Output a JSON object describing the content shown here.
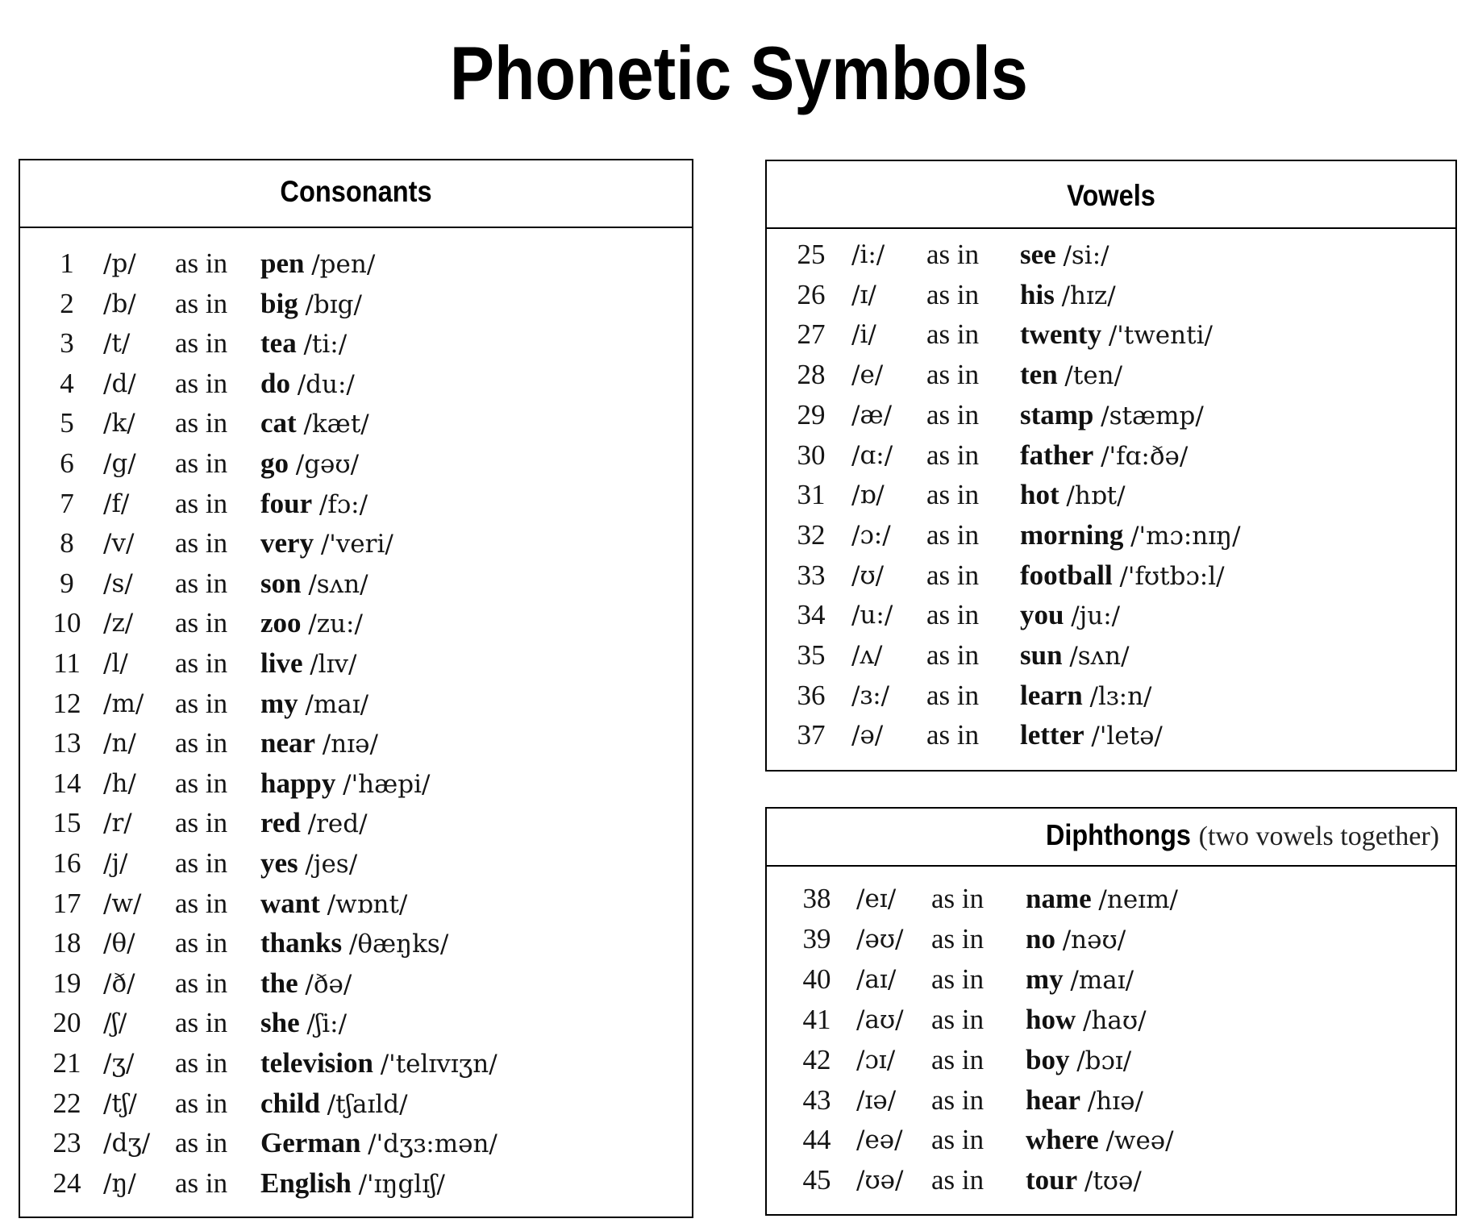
{
  "title": "Phonetic Symbols",
  "consonants": {
    "heading": "Consonants",
    "rows": [
      {
        "n": "1",
        "sym": "/p/",
        "as_in": "as in",
        "word": "pen",
        "ipa": "/pen/"
      },
      {
        "n": "2",
        "sym": "/b/",
        "as_in": "as in",
        "word": "big",
        "ipa": "/bɪg/"
      },
      {
        "n": "3",
        "sym": "/t/",
        "as_in": "as in",
        "word": "tea",
        "ipa": "/ti:/"
      },
      {
        "n": "4",
        "sym": "/d/",
        "as_in": "as in",
        "word": "do",
        "ipa": "/du:/"
      },
      {
        "n": "5",
        "sym": "/k/",
        "as_in": "as in",
        "word": "cat",
        "ipa": "/kæt/"
      },
      {
        "n": "6",
        "sym": "/g/",
        "as_in": "as in",
        "word": "go",
        "ipa": "/gəʊ/"
      },
      {
        "n": "7",
        "sym": "/f/",
        "as_in": "as in",
        "word": "four",
        "ipa": "/fɔ:/"
      },
      {
        "n": "8",
        "sym": "/v/",
        "as_in": "as in",
        "word": "very",
        "ipa": "/'veri/"
      },
      {
        "n": "9",
        "sym": "/s/",
        "as_in": "as in",
        "word": "son",
        "ipa": "/sʌn/"
      },
      {
        "n": "10",
        "sym": "/z/",
        "as_in": "as in",
        "word": "zoo",
        "ipa": "/zu:/"
      },
      {
        "n": "11",
        "sym": "/l/",
        "as_in": "as in",
        "word": "live",
        "ipa": "/lɪv/"
      },
      {
        "n": "12",
        "sym": "/m/",
        "as_in": "as in",
        "word": "my",
        "ipa": "/maɪ/"
      },
      {
        "n": "13",
        "sym": "/n/",
        "as_in": "as in",
        "word": "near",
        "ipa": "/nɪə/"
      },
      {
        "n": "14",
        "sym": "/h/",
        "as_in": "as in",
        "word": "happy",
        "ipa": "/'hæpi/"
      },
      {
        "n": "15",
        "sym": "/r/",
        "as_in": "as in",
        "word": "red",
        "ipa": "/red/"
      },
      {
        "n": "16",
        "sym": "/j/",
        "as_in": "as in",
        "word": "yes",
        "ipa": "/jes/"
      },
      {
        "n": "17",
        "sym": "/w/",
        "as_in": "as in",
        "word": "want",
        "ipa": "/wɒnt/"
      },
      {
        "n": "18",
        "sym": "/θ/",
        "as_in": "as in",
        "word": "thanks",
        "ipa": "/θæŋks/"
      },
      {
        "n": "19",
        "sym": "/ð/",
        "as_in": "as in",
        "word": "the",
        "ipa": "/ðə/"
      },
      {
        "n": "20",
        "sym": "/ʃ/",
        "as_in": "as in",
        "word": "she",
        "ipa": "/ʃi:/"
      },
      {
        "n": "21",
        "sym": "/ʒ/",
        "as_in": "as in",
        "word": "television",
        "ipa": "/'telɪvɪʒn/"
      },
      {
        "n": "22",
        "sym": "/tʃ/",
        "as_in": "as in",
        "word": "child",
        "ipa": "/tʃaɪld/"
      },
      {
        "n": "23",
        "sym": "/dʒ/",
        "as_in": "as in",
        "word": "German",
        "ipa": "/'dʒɜ:mən/"
      },
      {
        "n": "24",
        "sym": "/ŋ/",
        "as_in": "as in",
        "word": "English",
        "ipa": "/'ɪŋglɪʃ/"
      }
    ]
  },
  "vowels": {
    "heading": "Vowels",
    "rows": [
      {
        "n": "25",
        "sym": "/i:/",
        "as_in": "as in",
        "word": "see",
        "ipa": "/si:/"
      },
      {
        "n": "26",
        "sym": "/ɪ/",
        "as_in": "as in",
        "word": "his",
        "ipa": "/hɪz/"
      },
      {
        "n": "27",
        "sym": "/i/",
        "as_in": "as in",
        "word": "twenty",
        "ipa": "/'twenti/"
      },
      {
        "n": "28",
        "sym": "/e/",
        "as_in": "as in",
        "word": "ten",
        "ipa": "/ten/"
      },
      {
        "n": "29",
        "sym": "/æ/",
        "as_in": "as in",
        "word": "stamp",
        "ipa": "/stæmp/"
      },
      {
        "n": "30",
        "sym": "/ɑ:/",
        "as_in": "as in",
        "word": "father",
        "ipa": "/'fɑ:ðə/"
      },
      {
        "n": "31",
        "sym": "/ɒ/",
        "as_in": "as in",
        "word": "hot",
        "ipa": "/hɒt/"
      },
      {
        "n": "32",
        "sym": "/ɔ:/",
        "as_in": "as in",
        "word": "morning",
        "ipa": "/'mɔ:nɪŋ/"
      },
      {
        "n": "33",
        "sym": "/ʊ/",
        "as_in": "as in",
        "word": "football",
        "ipa": "/'fʊtbɔ:l/"
      },
      {
        "n": "34",
        "sym": "/u:/",
        "as_in": "as in",
        "word": "you",
        "ipa": "/ju:/"
      },
      {
        "n": "35",
        "sym": "/ʌ/",
        "as_in": "as in",
        "word": "sun",
        "ipa": "/sʌn/"
      },
      {
        "n": "36",
        "sym": "/ɜ:/",
        "as_in": "as in",
        "word": "learn",
        "ipa": "/lɜ:n/"
      },
      {
        "n": "37",
        "sym": "/ə/",
        "as_in": "as in",
        "word": "letter",
        "ipa": "/'letə/"
      }
    ]
  },
  "diphthongs": {
    "heading": "Diphthongs",
    "subheading": "(two vowels together)",
    "rows": [
      {
        "n": "38",
        "sym": "/eɪ/",
        "as_in": "as in",
        "word": "name",
        "ipa": "/neɪm/"
      },
      {
        "n": "39",
        "sym": "/əʊ/",
        "as_in": "as in",
        "word": "no",
        "ipa": "/nəʊ/"
      },
      {
        "n": "40",
        "sym": "/aɪ/",
        "as_in": "as in",
        "word": "my",
        "ipa": "/maɪ/"
      },
      {
        "n": "41",
        "sym": "/aʊ/",
        "as_in": "as in",
        "word": "how",
        "ipa": "/haʊ/"
      },
      {
        "n": "42",
        "sym": "/ɔɪ/",
        "as_in": "as in",
        "word": "boy",
        "ipa": "/bɔɪ/"
      },
      {
        "n": "43",
        "sym": "/ɪə/",
        "as_in": "as in",
        "word": "hear",
        "ipa": "/hɪə/"
      },
      {
        "n": "44",
        "sym": "/eə/",
        "as_in": "as in",
        "word": "where",
        "ipa": "/weə/"
      },
      {
        "n": "45",
        "sym": "/ʊə/",
        "as_in": "as in",
        "word": "tour",
        "ipa": "/tʊə/"
      }
    ]
  }
}
